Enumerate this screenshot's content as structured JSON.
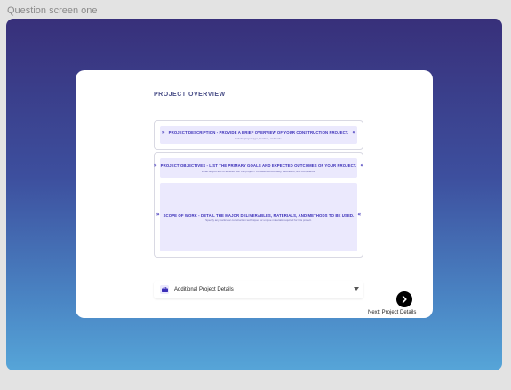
{
  "frame": {
    "label": "Question screen one"
  },
  "card": {
    "title": "PROJECT OVERVIEW",
    "sections": [
      {
        "heading": "PROJECT DESCRIPTION - PROVIDE A BRIEF OVERVIEW OF YOUR CONSTRUCTION PROJECT.",
        "subtext": "Include project type, location, and scale."
      },
      {
        "heading": "PROJECT OBJECTIVES - LIST THE PRIMARY GOALS AND EXPECTED OUTCOMES OF YOUR PROJECT.",
        "subtext": "What do you aim to achieve with this project? Consider functionality, aesthetics, and compliance."
      },
      {
        "heading": "SCOPE OF WORK - DETAIL THE MAJOR DELIVERABLES, MATERIALS, AND METHODS TO BE USED.",
        "subtext": "Specify any particular construction techniques or unique materials required for this project."
      }
    ],
    "dropdown": {
      "label": "Additional Project Details",
      "icon": "briefcase-icon"
    },
    "next": {
      "label": "Next: Project Details",
      "icon": "chevron-right-icon"
    }
  },
  "colors": {
    "accent": "#3b2fb8",
    "panel_bg": "#ebe9fd",
    "gradient_top": "#38307a",
    "gradient_bottom": "#56a5d8"
  }
}
